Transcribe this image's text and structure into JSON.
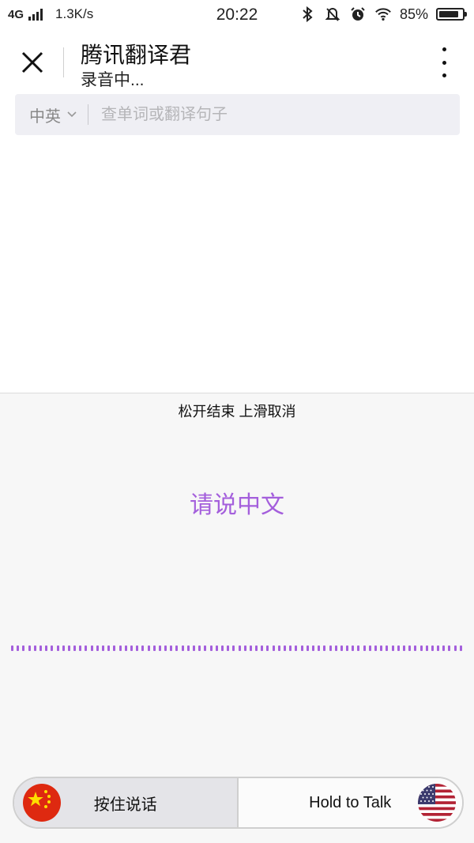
{
  "status_bar": {
    "network": "4G",
    "speed": "1.3K/s",
    "time": "20:22",
    "battery": "85%",
    "battery_level": 0.85,
    "icons": [
      "signal-icon",
      "bluetooth-icon",
      "notification-off-icon",
      "alarm-icon",
      "wifi-icon",
      "battery-icon"
    ]
  },
  "header": {
    "title": "腾讯翻译君",
    "subtitle": "录音中..."
  },
  "search": {
    "language": "中英",
    "placeholder": "查单词或翻译句子"
  },
  "recording": {
    "hint": "松开结束 上滑取消",
    "prompt": "请说中文"
  },
  "talk": {
    "left_label": "按住说话",
    "right_label": "Hold to Talk"
  },
  "colors": {
    "accent": "#a45fdc",
    "panel_bg": "#f7f7f7",
    "search_bg": "#efeff4"
  }
}
